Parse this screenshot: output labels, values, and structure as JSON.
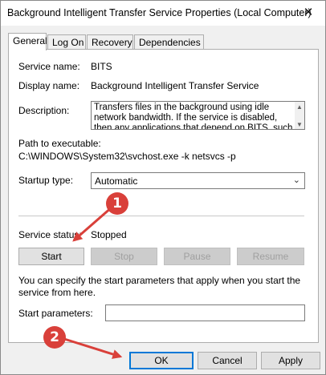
{
  "window": {
    "title": "Background Intelligent Transfer Service Properties (Local Computer)",
    "close_glyph": "✕"
  },
  "tabs": [
    {
      "label": "General",
      "active": true
    },
    {
      "label": "Log On",
      "active": false
    },
    {
      "label": "Recovery",
      "active": false
    },
    {
      "label": "Dependencies",
      "active": false
    }
  ],
  "general": {
    "service_name_label": "Service name:",
    "service_name": "BITS",
    "display_name_label": "Display name:",
    "display_name": "Background Intelligent Transfer Service",
    "description_label": "Description:",
    "description": "Transfers files in the background using idle network bandwidth. If the service is disabled, then any applications that depend on BITS, such as Windows",
    "path_label": "Path to executable:",
    "path": "C:\\WINDOWS\\System32\\svchost.exe -k netsvcs -p",
    "startup_type_label": "Startup type:",
    "startup_type": "Automatic",
    "service_status_label": "Service status:",
    "service_status": "Stopped",
    "buttons": {
      "start": "Start",
      "stop": "Stop",
      "pause": "Pause",
      "resume": "Resume"
    },
    "hint": "You can specify the start parameters that apply when you start the service from here.",
    "start_params_label": "Start parameters:",
    "start_params_value": ""
  },
  "footer": {
    "ok": "OK",
    "cancel": "Cancel",
    "apply": "Apply"
  },
  "annotations": [
    {
      "number": "1",
      "color": "#d9403a"
    },
    {
      "number": "2",
      "color": "#d9403a"
    }
  ]
}
